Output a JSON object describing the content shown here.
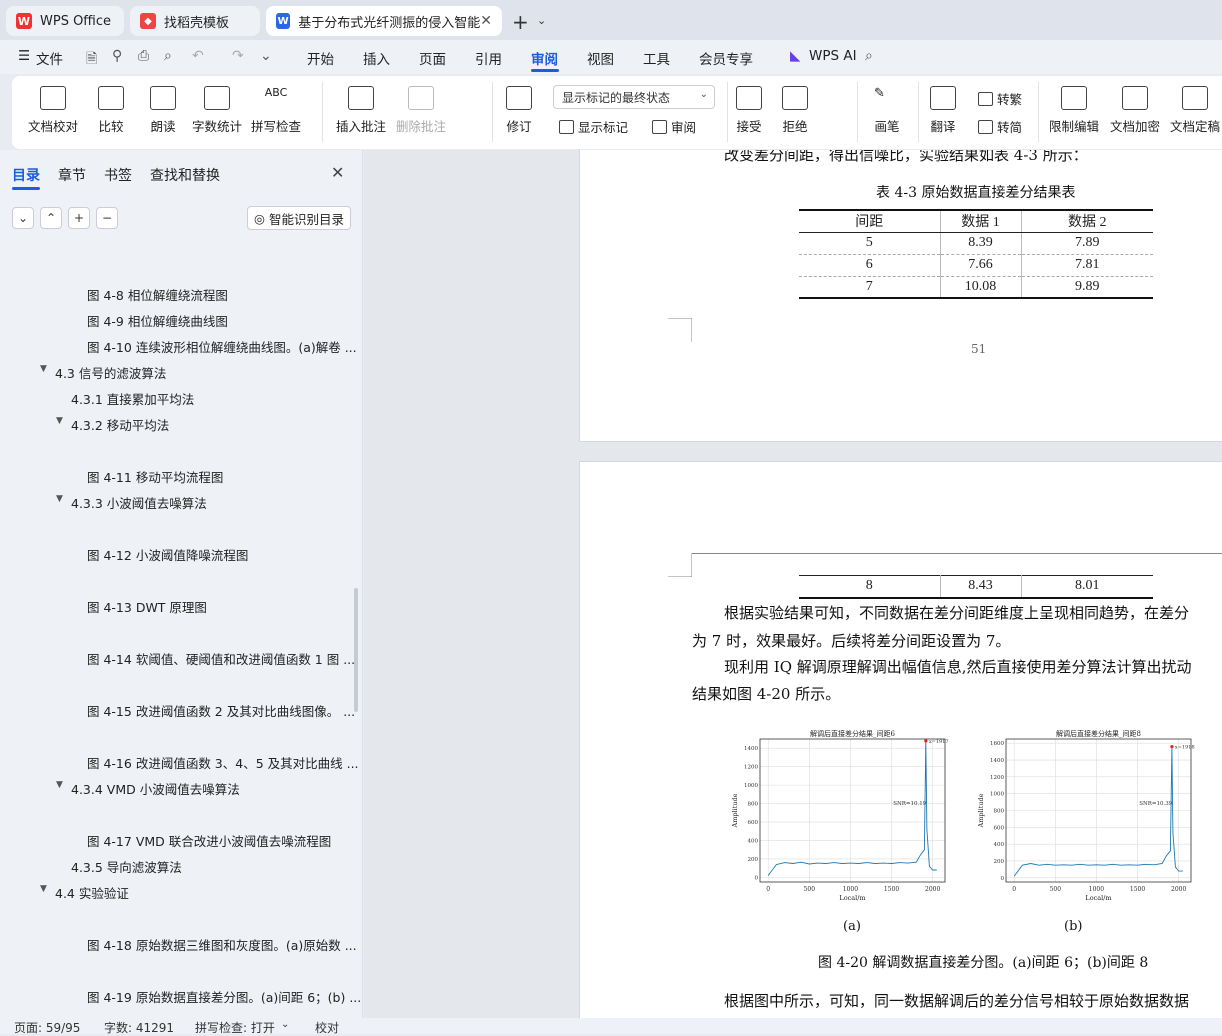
{
  "tabs": {
    "wps": "WPS Office",
    "template": "找稻壳模板",
    "document": "基于分布式光纤测振的侵入智能"
  },
  "menu": {
    "file": "文件",
    "items": [
      "开始",
      "插入",
      "页面",
      "引用",
      "审阅",
      "视图",
      "工具",
      "会员专享"
    ],
    "wps_ai": "WPS AI"
  },
  "ribbon": {
    "doc_check": "文档校对",
    "compare": "比较",
    "read_aloud": "朗读",
    "word_count": "字数统计",
    "spell_check": "拼写检查",
    "insert_comment": "插入批注",
    "delete_comment": "删除批注",
    "track_changes": "修订",
    "markup_state": "显示标记的最终状态",
    "show_markup": "显示标记",
    "review": "审阅",
    "accept": "接受",
    "reject": "拒绝",
    "pen": "画笔",
    "translate": "翻译",
    "to_traditional": "转繁",
    "to_simplified": "转简",
    "restrict_edit": "限制编辑",
    "encrypt": "文档加密",
    "finalize": "文档定稿"
  },
  "sidebar": {
    "tabs": [
      "目录",
      "章节",
      "书签",
      "查找和替换"
    ],
    "smart_toc": "智能识别目录",
    "toc": [
      {
        "text": "图 4-8  相位解缠绕流程图",
        "indent": 3
      },
      {
        "text": "图 4-9  相位解缠绕曲线图",
        "indent": 3
      },
      {
        "text": "图 4-10  连续波形相位解缠绕曲线图。(a)解卷 ...",
        "indent": 3
      },
      {
        "text": "4.3  信号的滤波算法",
        "indent": 1,
        "arrow": "▼"
      },
      {
        "text": "4.3.1  直接累加平均法",
        "indent": 2
      },
      {
        "text": "4.3.2  移动平均法",
        "indent": 2,
        "arrow": "▼"
      },
      {
        "text": "图 4-11  移动平均流程图",
        "indent": 3
      },
      {
        "text": "4.3.3  小波阈值去噪算法",
        "indent": 2,
        "arrow": "▼"
      },
      {
        "text": "图 4-12  小波阈值降噪流程图",
        "indent": 3
      },
      {
        "text": "图 4-13  DWT 原理图",
        "indent": 3
      },
      {
        "text": "图 4-14  软阈值、硬阈值和改进阈值函数 1 图 ...",
        "indent": 3
      },
      {
        "text": "图 4-15  改进阈值函数 2 及其对比曲线图像。 ...",
        "indent": 3
      },
      {
        "text": "图 4-16  改进阈值函数 3、4、5 及其对比曲线 ...",
        "indent": 3
      },
      {
        "text": "4.3.4 VMD 小波阈值去噪算法",
        "indent": 2,
        "arrow": "▼"
      },
      {
        "text": "图 4-17  VMD 联合改进小波阈值去噪流程图",
        "indent": 3
      },
      {
        "text": "4.3.5  导向滤波算法",
        "indent": 2
      },
      {
        "text": "4.4  实验验证",
        "indent": 1,
        "arrow": "▼"
      },
      {
        "text": "图 4-18  原始数据三维图和灰度图。(a)原始数 ...",
        "indent": 3
      },
      {
        "text": "图 4-19  原始数据直接差分图。(a)间距 6；(b) ...",
        "indent": 3
      }
    ]
  },
  "document": {
    "p_top": "改变差分间距，得出信噪比，实验结果如表 4-3 所示：",
    "table_caption": "表 4-3  原始数据直接差分结果表",
    "table_headers": [
      "间距",
      "数据 1",
      "数据 2"
    ],
    "table_rows": [
      [
        "5",
        "8.39",
        "7.89"
      ],
      [
        "6",
        "7.66",
        "7.81"
      ],
      [
        "7",
        "10.08",
        "9.89"
      ]
    ],
    "page_number": "51",
    "table_row_cont": [
      "8",
      "8.43",
      "8.01"
    ],
    "para1_line1": "根据实验结果可知，不同数据在差分间距维度上呈现相同趋势，在差分",
    "para1_line2": "为 7 时，效果最好。后续将差分间距设置为 7。",
    "para2_line1": "现利用 IQ 解调原理解调出幅值信息,然后直接使用差分算法计算出扰动",
    "para2_line2": "结果如图 4-20 所示。",
    "fig_label_a": "(a)",
    "fig_label_b": "(b)",
    "fig_caption": "图 4-20  解调数据直接差分图。(a)间距 6；(b)间距 8",
    "para3_line1": "根据图中所示，可知，同一数据解调后的差分信号相较于原始数据数据"
  },
  "chart_data": [
    {
      "type": "line",
      "title": "解调后直接差分结果_间距6",
      "xlabel": "Local/m",
      "ylabel": "Amplitude",
      "xlim": [
        -100,
        2150
      ],
      "ylim": [
        -50,
        1500
      ],
      "x_ticks": [
        0,
        500,
        1000,
        1500,
        2000
      ],
      "y_ticks": [
        0,
        200,
        400,
        600,
        800,
        1000,
        1200,
        1400
      ],
      "annotations": [
        "x=1917",
        "SNR=10.19"
      ],
      "grid": true,
      "peak": {
        "x": 1917,
        "y": 1480
      },
      "series": [
        {
          "x": [
            0,
            100,
            200,
            300,
            400,
            500,
            600,
            700,
            800,
            900,
            1000,
            1100,
            1200,
            1300,
            1400,
            1500,
            1600,
            1700,
            1800,
            1850,
            1900,
            1917,
            1930,
            1960,
            2000,
            2050
          ],
          "y": [
            20,
            140,
            160,
            150,
            165,
            145,
            155,
            150,
            160,
            150,
            155,
            150,
            160,
            150,
            155,
            150,
            160,
            155,
            165,
            240,
            300,
            1480,
            520,
            120,
            80,
            80
          ]
        }
      ]
    },
    {
      "type": "line",
      "title": "解调后直接差分结果_间距8",
      "xlabel": "Local/m",
      "ylabel": "Amplitude",
      "xlim": [
        -100,
        2150
      ],
      "ylim": [
        -50,
        1650
      ],
      "x_ticks": [
        0,
        500,
        1000,
        1500,
        2000
      ],
      "y_ticks": [
        0,
        200,
        400,
        600,
        800,
        1000,
        1200,
        1400,
        1600
      ],
      "annotations": [
        "x=1918",
        "SNR=10.39"
      ],
      "grid": true,
      "peak": {
        "x": 1918,
        "y": 1560
      },
      "series": [
        {
          "x": [
            0,
            100,
            200,
            300,
            400,
            500,
            600,
            700,
            800,
            900,
            1000,
            1100,
            1200,
            1300,
            1400,
            1500,
            1600,
            1700,
            1800,
            1850,
            1900,
            1918,
            1930,
            1960,
            2000,
            2050
          ],
          "y": [
            20,
            150,
            170,
            150,
            160,
            150,
            155,
            150,
            160,
            150,
            155,
            150,
            160,
            150,
            155,
            150,
            160,
            155,
            170,
            260,
            320,
            1560,
            540,
            130,
            80,
            80
          ]
        }
      ]
    }
  ],
  "status": {
    "page": "页面: 59/95",
    "words": "字数: 41291",
    "spell": "拼写检查: 打开",
    "proof": "校对"
  }
}
